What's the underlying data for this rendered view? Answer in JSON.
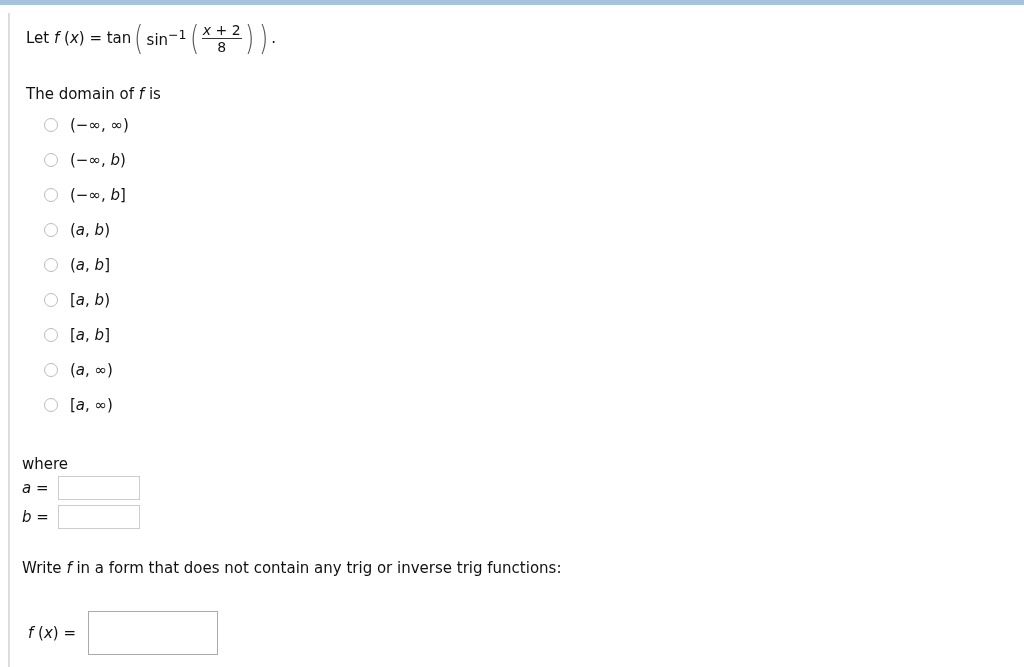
{
  "formula": {
    "lead": "Let *f* (*x*) = tan",
    "outer_open": "(",
    "func": "sin$^{−1}$",
    "inner_open": "(",
    "numerator": "*x* + 2",
    "denominator": "8",
    "inner_close": ")",
    "outer_close": ")",
    "period": "."
  },
  "domain_prompt": "The domain of *f* is",
  "options": [
    {
      "label": "(−∞, ∞)",
      "selected": false
    },
    {
      "label": "(−∞, *b*)",
      "selected": false
    },
    {
      "label": "(−∞, *b*]",
      "selected": false
    },
    {
      "label": "(*a*, *b*)",
      "selected": false
    },
    {
      "label": "(*a*, *b*]",
      "selected": false
    },
    {
      "label": "[*a*, *b*)",
      "selected": false
    },
    {
      "label": "[*a*, *b*]",
      "selected": false
    },
    {
      "label": "(*a*, ∞)",
      "selected": false
    },
    {
      "label": "[*a*, ∞)",
      "selected": false
    }
  ],
  "where_label": "where",
  "endpoints": [
    {
      "label": "*a* ="
    },
    {
      "label": "*b* ="
    }
  ],
  "rewrite_prompt": "Write *f* in a form that does not contain any trig or inverse trig functions:",
  "answer_label": "*f* (*x*) ="
}
